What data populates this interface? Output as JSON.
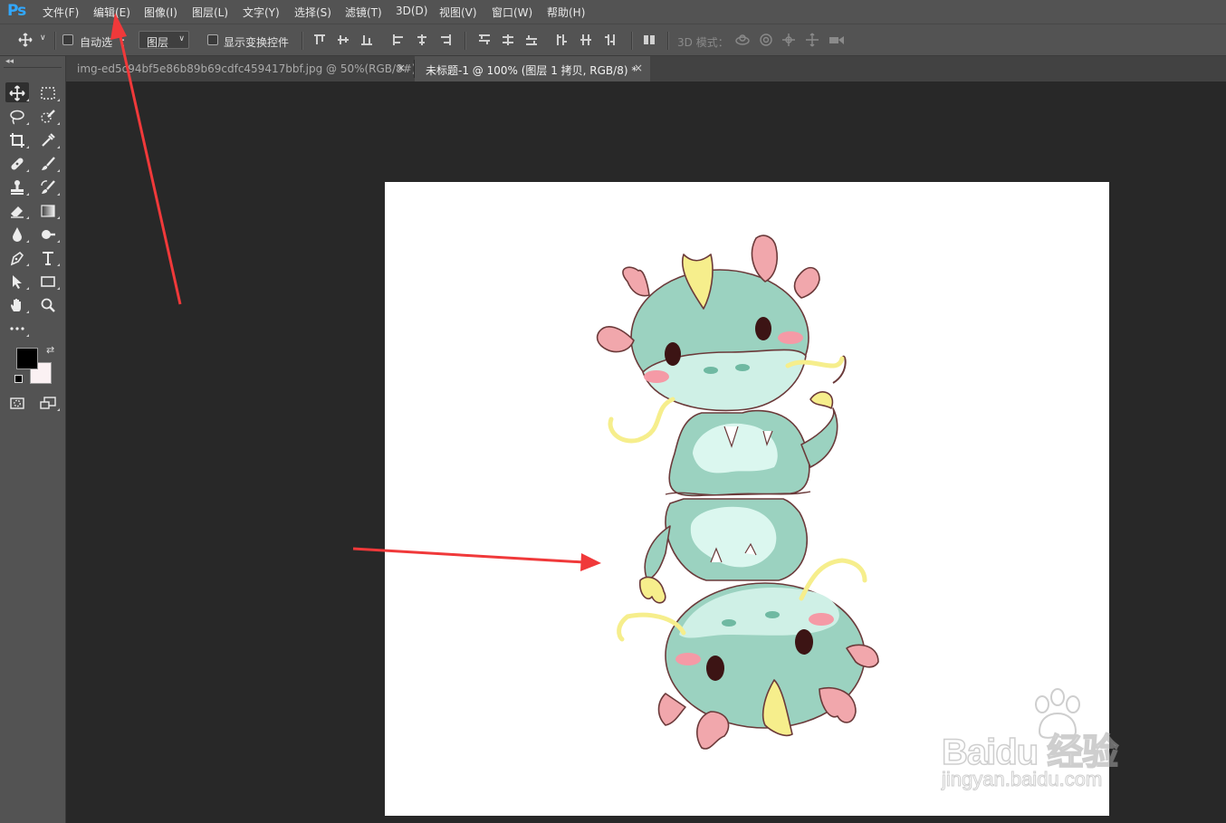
{
  "app": {
    "logo": "Ps"
  },
  "menu": [
    "文件(F)",
    "编辑(E)",
    "图像(I)",
    "图层(L)",
    "文字(Y)",
    "选择(S)",
    "滤镜(T)",
    "3D(D)",
    "视图(V)",
    "窗口(W)",
    "帮助(H)"
  ],
  "options_bar": {
    "auto_select_label": "自动选",
    "auto_select_colon": "：",
    "auto_select_target": "图层",
    "show_transform_label": "显示变换控件",
    "mode_3d_label": "3D 模式："
  },
  "tabs": [
    {
      "title": "img-ed5c",
      "title_rest": "94bf5e86b89b69cdfc459417bbf.jpg @ 50%(RGB/8#)",
      "close": "×",
      "active": false
    },
    {
      "title": "未标题-1 @ 100% (图层 1 拷贝, RGB/8) *",
      "close": "×",
      "active": true
    }
  ],
  "toolbar": {
    "collapse_glyph": "◂◂",
    "tools": [
      "move-tool",
      "marquee-tool",
      "lasso-tool",
      "quick-select-tool",
      "crop-tool",
      "eyedropper-tool",
      "healing-brush-tool",
      "brush-tool",
      "clone-stamp-tool",
      "history-brush-tool",
      "eraser-tool",
      "gradient-tool",
      "blur-tool",
      "dodge-tool",
      "pen-tool",
      "type-tool",
      "path-select-tool",
      "rectangle-tool",
      "hand-tool",
      "zoom-tool",
      "edit-toolbar"
    ],
    "foreground_color": "#000000",
    "background_color": "#fbf1f3"
  },
  "canvas": {
    "background": "#ffffff",
    "artwork": "two stacked teal cartoon dragons"
  },
  "annotation_color": "#f0393a",
  "watermark": {
    "main": "Bai",
    "main2": "du",
    "brand_cn": "经验",
    "sub": "jingyan.baidu.com"
  }
}
